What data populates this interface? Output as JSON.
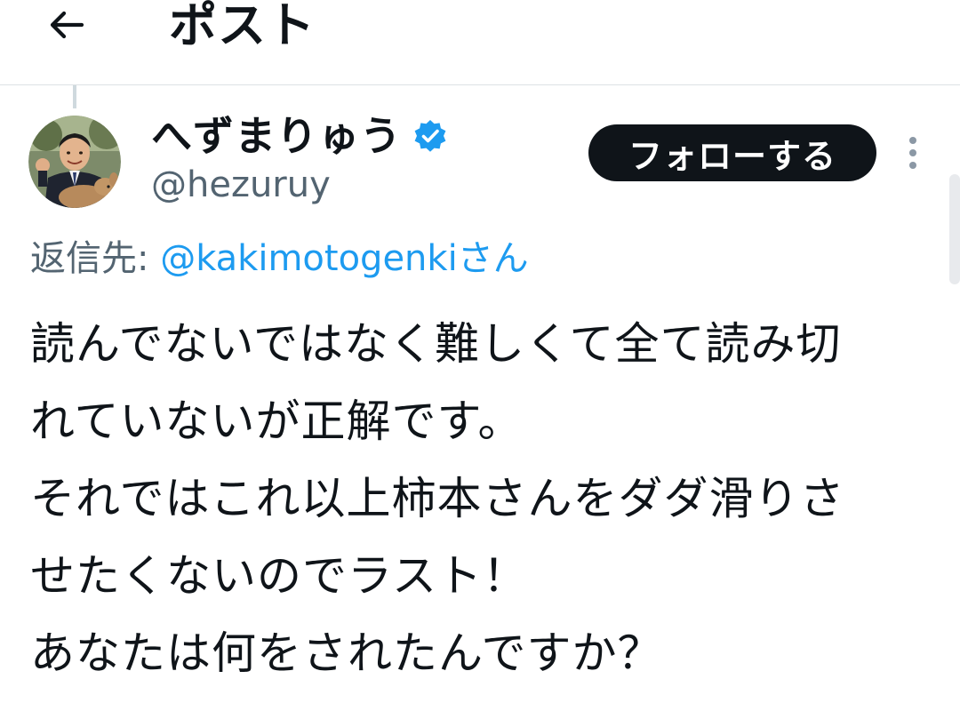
{
  "header": {
    "title": "ポスト"
  },
  "author": {
    "display_name": "へずまりゅう",
    "handle": "@hezuruy",
    "verified": true
  },
  "actions": {
    "follow_label": "フォローする"
  },
  "reply": {
    "prefix": "返信先: ",
    "mention": "@kakimotogenki",
    "suffix": "さん"
  },
  "tweet": {
    "lines": [
      "読んでないではなく難しくて全て読み切",
      "れていないが正解です。",
      "それではこれ以上柿本さんをダダ滑りさ",
      "せたくないのでラスト！",
      "あなたは何をされたんですか？"
    ]
  },
  "colors": {
    "accent": "#1d9bf0",
    "verified_badge": "#1d9bf0",
    "text_primary": "#0f1419",
    "text_secondary": "#536471",
    "follow_bg": "#0f1419",
    "divider": "#dde1e4"
  },
  "icons": {
    "back": "arrow-left-icon",
    "verified": "verified-badge-icon",
    "more": "more-vertical-icon"
  }
}
